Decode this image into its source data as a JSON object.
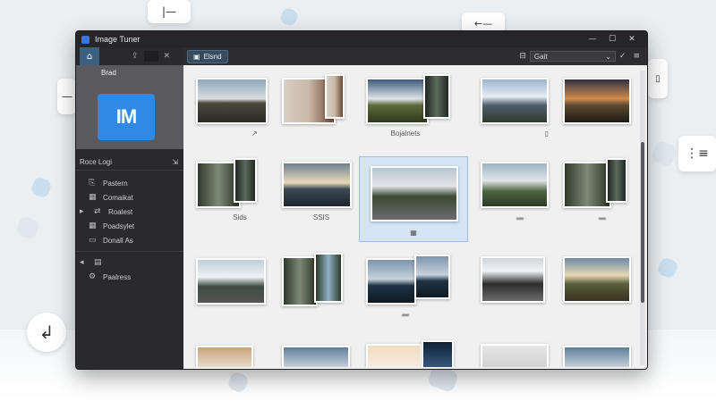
{
  "window": {
    "title": "Image Tuner"
  },
  "sidebar": {
    "preview_label": "Brad",
    "logo_text": "IM",
    "section_title": "Roce Logi",
    "items": [
      {
        "icon": "clip-icon",
        "label": "Pastern"
      },
      {
        "icon": "grid-icon",
        "label": "Comaikat"
      },
      {
        "icon": "chevron-right-icon",
        "label": "Roalest"
      },
      {
        "icon": "grid-icon",
        "label": "Poadsylet"
      },
      {
        "icon": "monitor-icon",
        "label": "Donall As"
      }
    ],
    "items2": [
      {
        "icon": "gear-icon",
        "label": "Paalress"
      }
    ]
  },
  "toolbar": {
    "tab_label": "Elsnd",
    "sort_value": "Gait"
  },
  "grid": {
    "captions": {
      "row1_col3": "Bojalnets",
      "row2_col1": "Sids",
      "row2_col2": "SSIS"
    }
  }
}
